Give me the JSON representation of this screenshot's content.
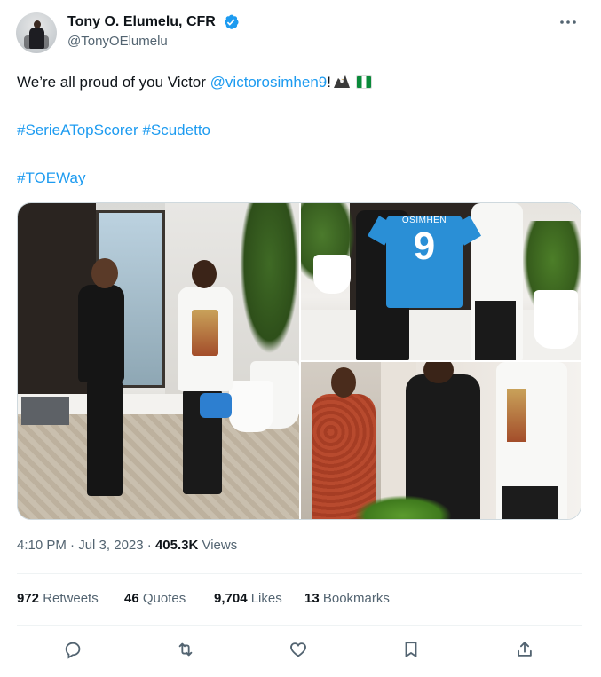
{
  "author": {
    "name": "Tony O. Elumelu, CFR",
    "handle": "@TonyOElumelu",
    "verified": true
  },
  "tweet": {
    "text_prefix": "We’re all proud of you Victor ",
    "mention": "@victorosimhen9",
    "text_suffix": "!",
    "hashtag_line1_a": "#SerieATopScorer",
    "hashtag_line1_b": "#Scudetto",
    "hashtag_line2": "#TOEWay"
  },
  "media": {
    "photo_count": 3,
    "jersey_name": "OSIMHEN",
    "jersey_number": "9"
  },
  "meta": {
    "time": "4:10 PM",
    "sep1": " · ",
    "date": "Jul 3, 2023",
    "sep2": " · ",
    "views_count": "405.3K",
    "views_label": " Views"
  },
  "stats": {
    "retweets_count": "972",
    "retweets_label": " Retweets",
    "quotes_count": "46",
    "quotes_label": " Quotes",
    "likes_count": "9,704",
    "likes_label": " Likes",
    "bookmarks_count": "13",
    "bookmarks_label": " Bookmarks"
  },
  "colors": {
    "link": "#1d9bf0",
    "text": "#0f1419",
    "secondary": "#536471",
    "verified_badge": "#1d9bf0"
  },
  "icons": {
    "verified": "verified-badge-icon",
    "more": "more-options-icon",
    "reply": "reply-icon",
    "retweet": "retweet-icon",
    "like": "heart-icon",
    "bookmark": "bookmark-icon",
    "share": "share-icon"
  }
}
